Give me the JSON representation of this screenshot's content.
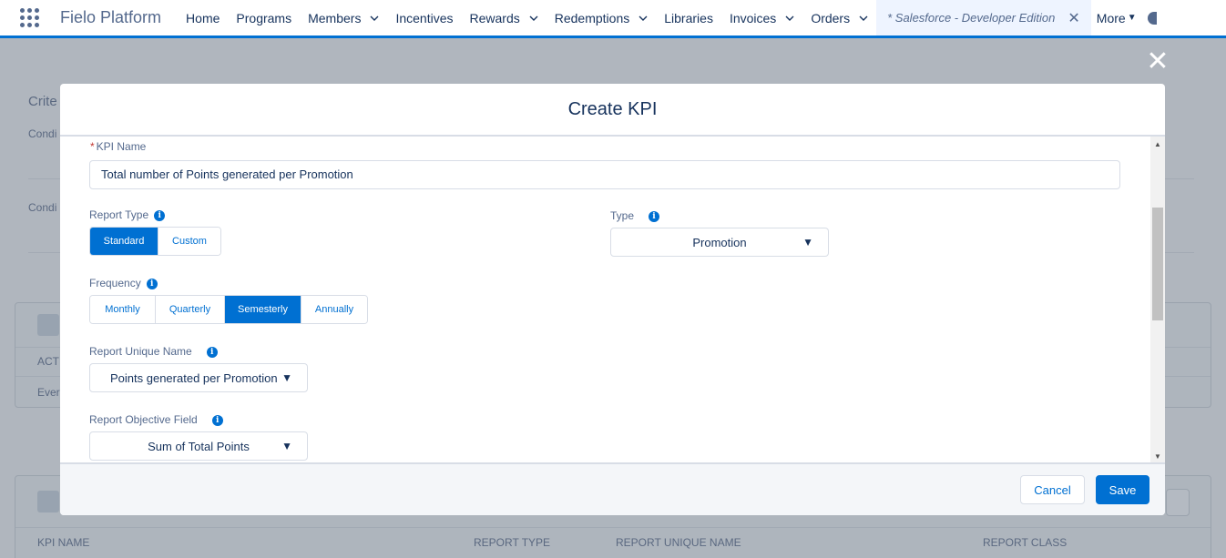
{
  "topnav": {
    "app_name": "Fielo Platform",
    "items": [
      {
        "label": "Home",
        "has_menu": false
      },
      {
        "label": "Programs",
        "has_menu": false
      },
      {
        "label": "Members",
        "has_menu": true
      },
      {
        "label": "Incentives",
        "has_menu": false
      },
      {
        "label": "Rewards",
        "has_menu": true
      },
      {
        "label": "Redemptions",
        "has_menu": true
      },
      {
        "label": "Libraries",
        "has_menu": false
      },
      {
        "label": "Invoices",
        "has_menu": true
      },
      {
        "label": "Orders",
        "has_menu": true
      }
    ],
    "active_tab": "* Salesforce - Developer Edition",
    "more_label": "More"
  },
  "background": {
    "crite": "Crite",
    "condi1": "Condi",
    "condi2": "Condi",
    "act": "ACT",
    "ever": "Ever",
    "col_kpi_name": "KPI NAME",
    "col_report_type": "REPORT TYPE",
    "col_report_unique_name": "REPORT UNIQUE NAME",
    "col_report_class": "REPORT CLASS"
  },
  "modal": {
    "title": "Create KPI",
    "kpi_name_label": "KPI Name",
    "kpi_name_required": "*",
    "kpi_name_value": "Total number of Points generated per Promotion",
    "report_type_label": "Report Type",
    "report_type_options": [
      "Standard",
      "Custom"
    ],
    "report_type_selected": "Standard",
    "type_label": "Type",
    "type_value": "Promotion",
    "frequency_label": "Frequency",
    "frequency_options": [
      "Monthly",
      "Quarterly",
      "Semesterly",
      "Annually"
    ],
    "frequency_selected": "Semesterly",
    "report_unique_name_label": "Report Unique Name",
    "report_unique_name_value": "Points generated per Promotion",
    "report_objective_field_label": "Report Objective Field",
    "report_objective_field_value": "Sum of Total Points",
    "cancel_label": "Cancel",
    "save_label": "Save"
  },
  "colors": {
    "brand": "#0070d2",
    "overlay": "#b0b6be",
    "text": "#16325c",
    "label": "#54698d",
    "required": "#c23934"
  },
  "icons": {
    "app_launcher": "waffle-icon",
    "menu": "chevron-down-icon",
    "close_tab": "close-icon",
    "close_modal": "close-icon",
    "info": "info-icon",
    "select_arrow": "caret-down-icon"
  }
}
